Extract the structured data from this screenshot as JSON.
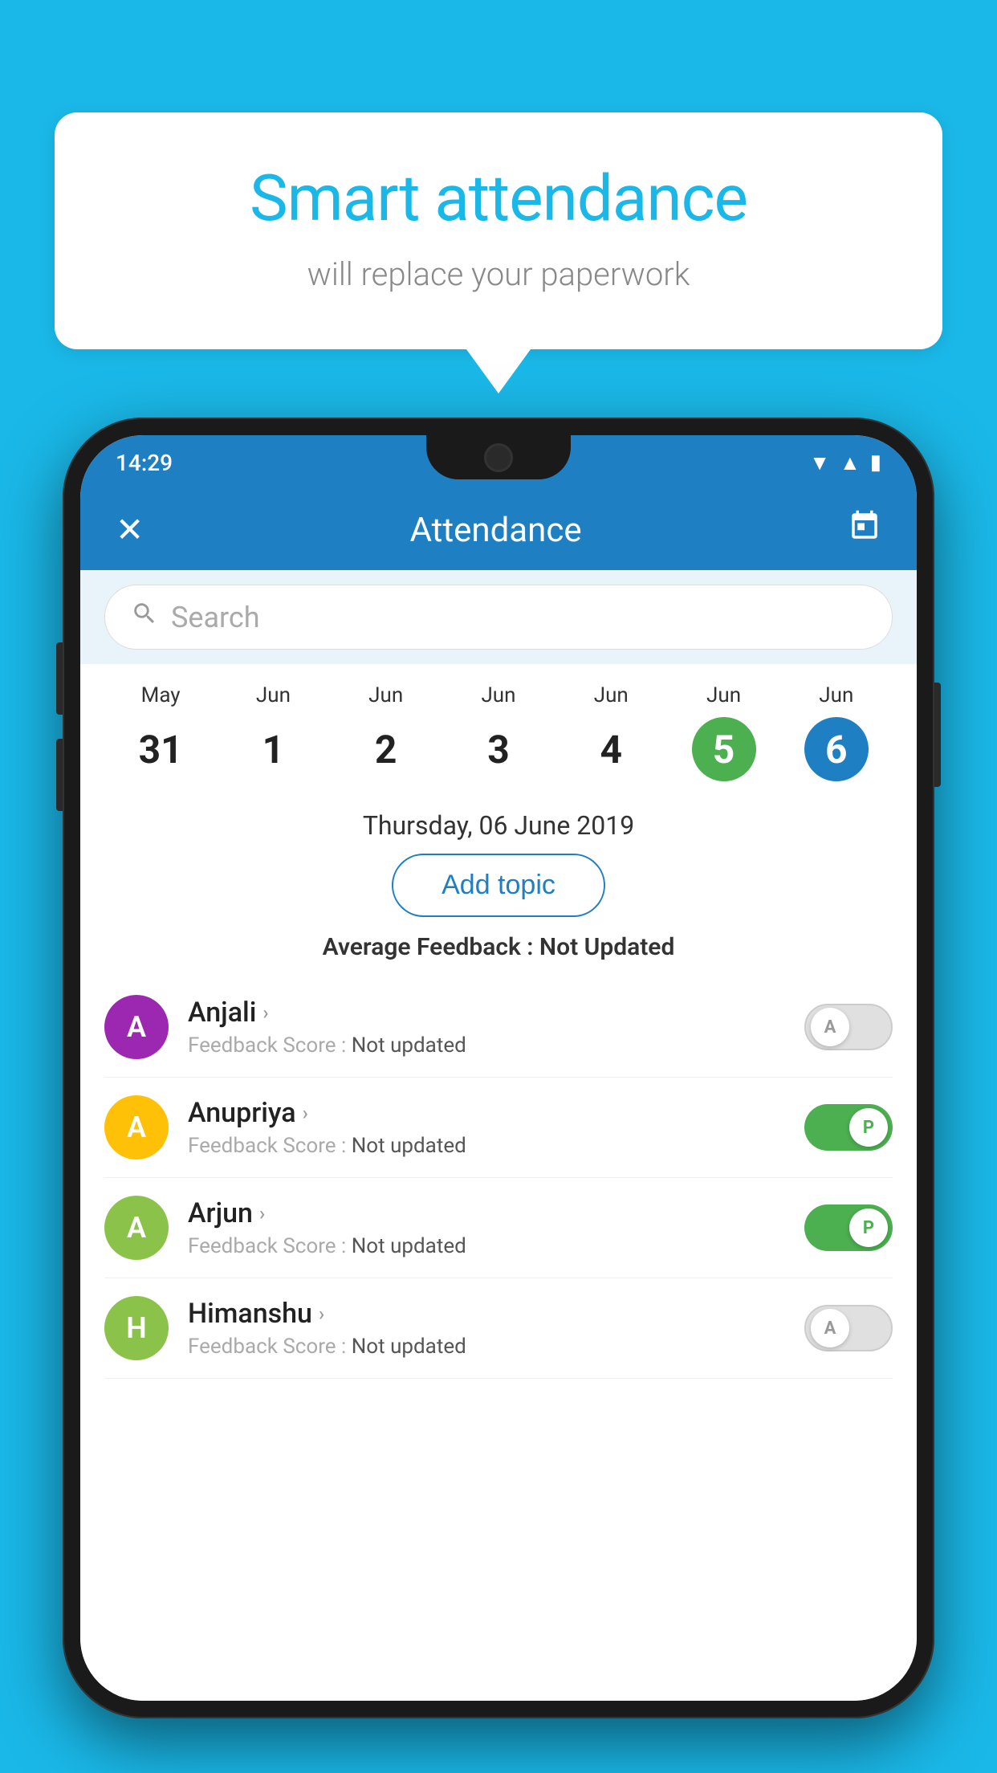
{
  "background_color": "#1ab8e8",
  "speech_bubble": {
    "title": "Smart attendance",
    "subtitle": "will replace your paperwork"
  },
  "status_bar": {
    "time": "14:29",
    "wifi": "▼",
    "signal": "▲",
    "battery": "▮"
  },
  "app_header": {
    "title": "Attendance",
    "close_label": "✕",
    "calendar_icon": "📅"
  },
  "search": {
    "placeholder": "Search"
  },
  "calendar": {
    "days": [
      {
        "month": "May",
        "date": "31",
        "style": "normal"
      },
      {
        "month": "Jun",
        "date": "1",
        "style": "normal"
      },
      {
        "month": "Jun",
        "date": "2",
        "style": "normal"
      },
      {
        "month": "Jun",
        "date": "3",
        "style": "normal"
      },
      {
        "month": "Jun",
        "date": "4",
        "style": "normal"
      },
      {
        "month": "Jun",
        "date": "5",
        "style": "green"
      },
      {
        "month": "Jun",
        "date": "6",
        "style": "blue"
      }
    ]
  },
  "selected_date": "Thursday, 06 June 2019",
  "add_topic_label": "Add topic",
  "avg_feedback_label": "Average Feedback :",
  "avg_feedback_value": "Not Updated",
  "students": [
    {
      "name": "Anjali",
      "avatar_letter": "A",
      "avatar_color": "#9c27b0",
      "feedback_label": "Feedback Score :",
      "feedback_value": "Not updated",
      "toggle_state": "off",
      "toggle_letter": "A"
    },
    {
      "name": "Anupriya",
      "avatar_letter": "A",
      "avatar_color": "#ffc107",
      "feedback_label": "Feedback Score :",
      "feedback_value": "Not updated",
      "toggle_state": "on",
      "toggle_letter": "P"
    },
    {
      "name": "Arjun",
      "avatar_letter": "A",
      "avatar_color": "#8bc34a",
      "feedback_label": "Feedback Score :",
      "feedback_value": "Not updated",
      "toggle_state": "on",
      "toggle_letter": "P"
    },
    {
      "name": "Himanshu",
      "avatar_letter": "H",
      "avatar_color": "#8bc34a",
      "feedback_label": "Feedback Score :",
      "feedback_value": "Not updated",
      "toggle_state": "off",
      "toggle_letter": "A"
    }
  ]
}
